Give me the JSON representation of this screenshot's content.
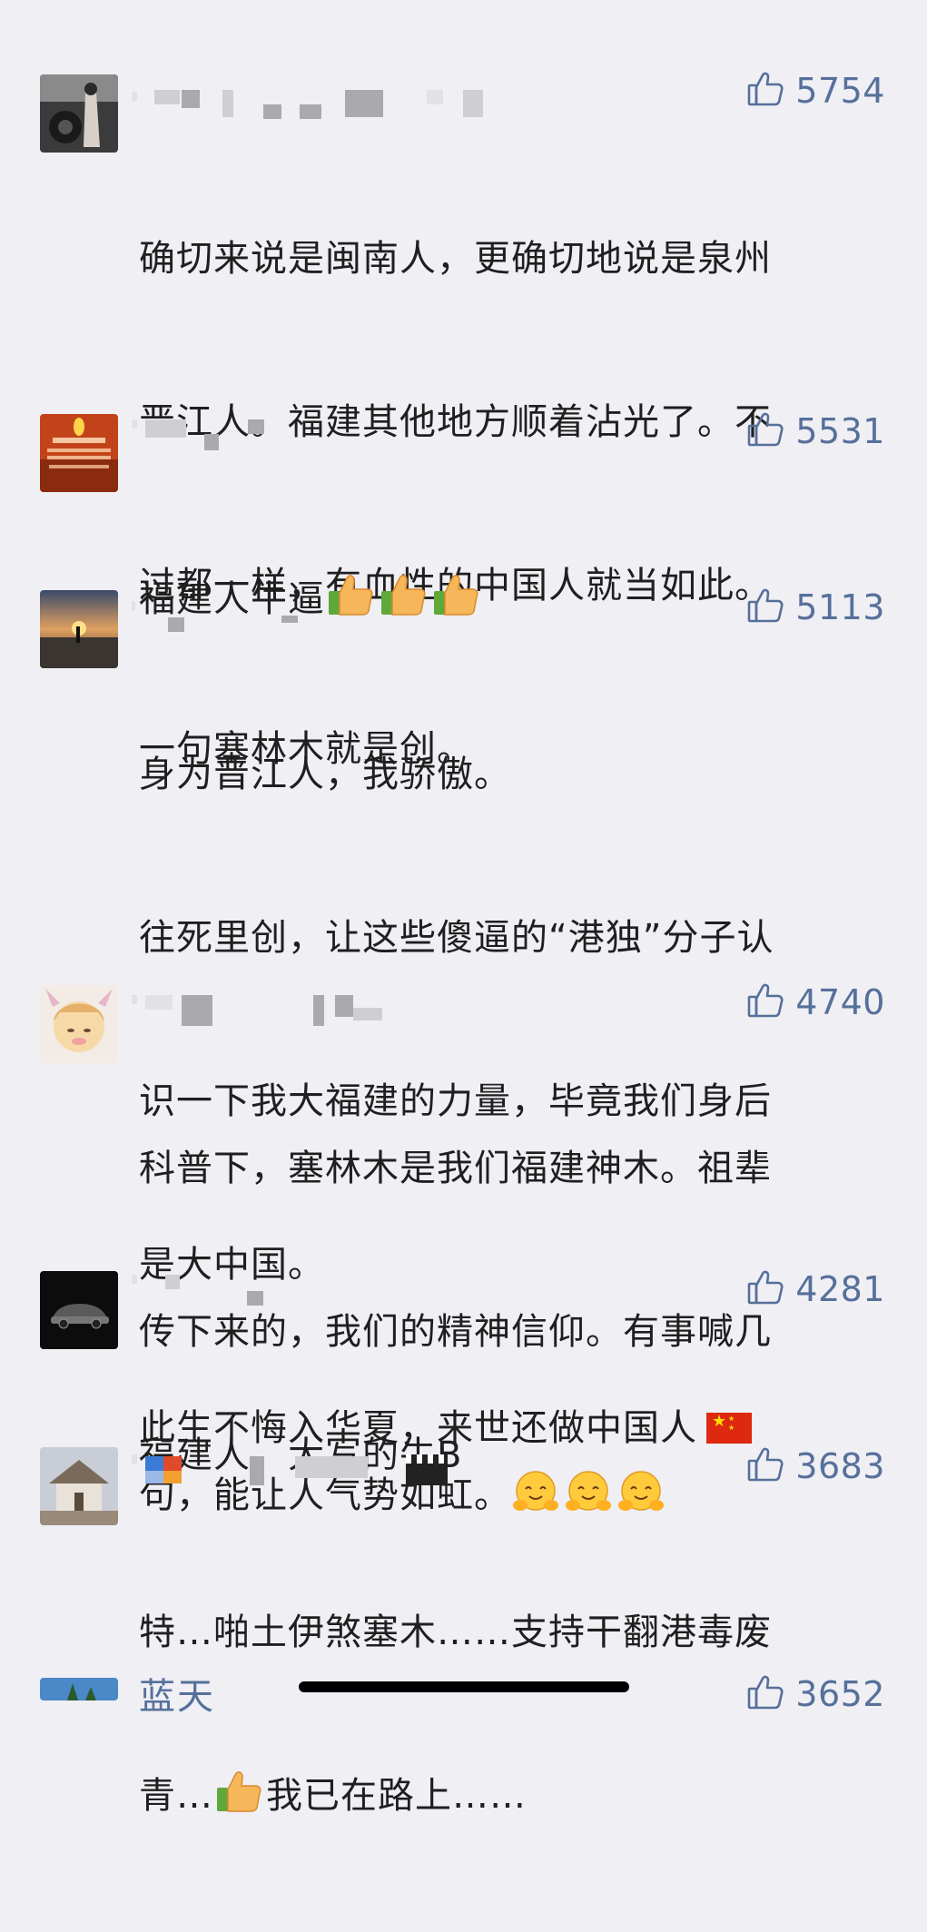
{
  "colors": {
    "background": "#efeff4",
    "like": "#56709a",
    "text": "#1f1f1f",
    "name_link": "#56709a"
  },
  "comments": [
    {
      "likes": "5754",
      "lines": [
        "确切来说是闽南人，更确切地说是泉州",
        "晋江人。福建其他地方顺着沾光了。不",
        "过都一样，有血性的中国人就当如此。",
        "一句塞林木就是创。"
      ]
    },
    {
      "likes": "5531",
      "lines": [
        "福建人牛逼"
      ],
      "emoji": [
        "thumbs-up-emoji",
        "thumbs-up-emoji",
        "thumbs-up-emoji"
      ]
    },
    {
      "likes": "5113",
      "lines": [
        "身为晋江人，我骄傲。",
        "往死里创，让这些傻逼的“港独”分子认",
        "识一下我大福建的力量，毕竟我们身后",
        "是大中国。",
        "此生不悔入华夏，来世还做中国人"
      ],
      "emoji": [
        "china-flag-emoji"
      ]
    },
    {
      "likes": "4740",
      "lines": [
        "科普下，塞林木是我们福建神木。祖辈",
        "传下来的，我们的精神信仰。有事喊几",
        "句，能让人气势如虹。"
      ],
      "emoji": [
        "hugging-face-emoji",
        "hugging-face-emoji",
        "hugging-face-emoji"
      ]
    },
    {
      "likes": "4281",
      "lines": [
        "福建人，大写的牛B"
      ]
    },
    {
      "likes": "3683",
      "line1": "特…啪土伊煞塞木……支持干翻港毒废",
      "line2a": "青…",
      "line2b": "我已在路上……",
      "emoji": [
        "thumbs-up-emoji",
        "clapper-board-emoji"
      ]
    }
  ],
  "partial_comment": {
    "name": "蓝天",
    "likes": "3652"
  },
  "icons": {
    "like": "thumbs-up-outline-icon"
  }
}
